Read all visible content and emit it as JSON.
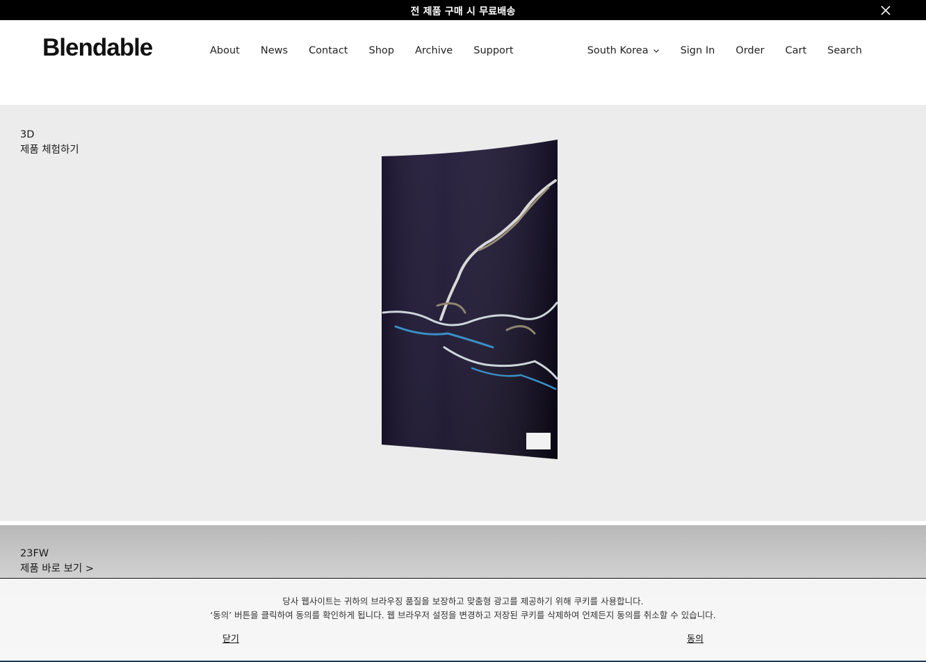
{
  "announcement": {
    "text": "전 제품 구매 시 무료배송",
    "close_icon": "close-icon"
  },
  "header": {
    "logo": "Blendable",
    "nav_left": [
      "About",
      "News",
      "Contact",
      "Shop",
      "Archive",
      "Support"
    ],
    "region": "South Korea",
    "nav_right": [
      "Sign In",
      "Order",
      "Cart",
      "Search"
    ]
  },
  "hero": {
    "label_line1": "3D",
    "label_line2": "제품 체험하기",
    "background": "#ececec",
    "product_color": "#1a1430"
  },
  "section2": {
    "label_line1": "23FW",
    "label_line2": "제품 바로 보기 >"
  },
  "cookie": {
    "line1": "당사 웹사이트는 귀하의 브라우징 품질을 보장하고 맞춤형 광고를 제공하기 위해 쿠키를 사용합니다.",
    "line2": "‘동의’ 버튼을 클릭하여 동의를 확인하게 됩니다. 웹 브라우저 설정을 변경하고 저장된 쿠키를 삭제하여 언제든지 동의를 취소할 수 있습니다.",
    "close_label": "닫기",
    "agree_label": "동의"
  }
}
